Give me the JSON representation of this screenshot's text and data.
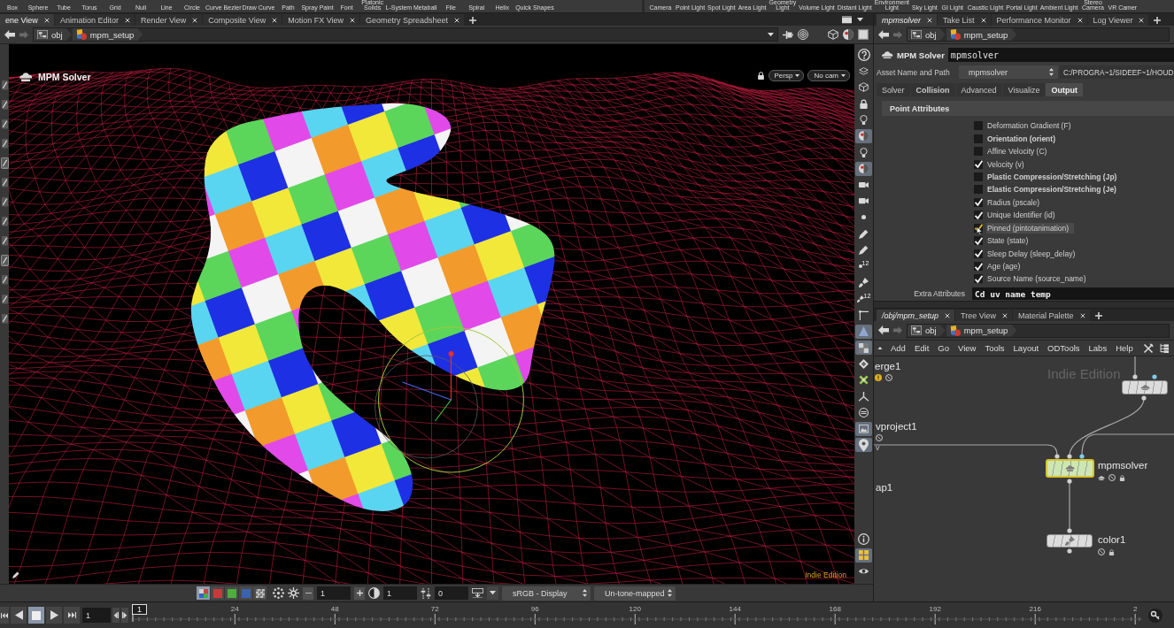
{
  "shelf": {
    "create_tools": [
      "Box",
      "Sphere",
      "Tube",
      "Torus",
      "Grid",
      "Null",
      "Line",
      "Circle",
      "Curve Bezier",
      "Draw Curve",
      "Path",
      "Spray Paint",
      "Font",
      "Platonic\nSolids",
      "L-System",
      "Metaball",
      "File",
      "Spiral",
      "Helix",
      "Quick Shapes"
    ],
    "light_tools": [
      "Camera",
      "Point Light",
      "Spot Light",
      "Area Light",
      "Geometry\nLight",
      "Volume Light",
      "Distant Light",
      "Environment\nLight",
      "Sky Light",
      "GI Light",
      "Caustic Light",
      "Portal Light",
      "Ambient Light",
      "Stereo\nCamera",
      "VR Camer"
    ]
  },
  "scene_tabs": [
    {
      "label": "ene View",
      "selected": true
    },
    {
      "label": "Animation Editor",
      "selected": false
    },
    {
      "label": "Render View",
      "selected": false
    },
    {
      "label": "Composite View",
      "selected": false
    },
    {
      "label": "Motion FX View",
      "selected": false
    },
    {
      "label": "Geometry Spreadsheet",
      "selected": false
    }
  ],
  "scene_path": [
    "obj",
    "mpm_setup"
  ],
  "left_tools": [
    {
      "selected": false
    },
    {
      "selected": false
    },
    {
      "selected": false
    },
    {
      "selected": false
    },
    {
      "selected": true
    },
    {
      "selected": false
    },
    {
      "selected": false
    },
    {
      "selected": false
    },
    {
      "selected": false
    },
    {
      "selected": true
    },
    {
      "selected": false
    },
    {
      "selected": false
    },
    {
      "selected": false
    }
  ],
  "viewport": {
    "title": "MPM Solver",
    "camera_menus": [
      "Persp",
      "No cam"
    ],
    "edition": "Indie Edition"
  },
  "viewport_tools": [
    {
      "kind": "help",
      "selected": false
    },
    {
      "kind": "layers",
      "selected": false
    },
    {
      "kind": "cube",
      "selected": false
    },
    {
      "kind": "lock",
      "selected": false
    },
    {
      "kind": "bulb",
      "selected": false
    },
    {
      "kind": "sphere",
      "selected": true
    },
    {
      "kind": "bulb",
      "selected": false
    },
    {
      "kind": "sphere",
      "selected": true
    },
    {
      "kind": "camera",
      "selected": false
    },
    {
      "kind": "camera",
      "selected": false
    },
    {
      "kind": "dot",
      "selected": false
    },
    {
      "kind": "pen",
      "selected": false
    },
    {
      "kind": "pen",
      "selected": false
    },
    {
      "kind": "dot",
      "selected": false,
      "badge": "12"
    },
    {
      "kind": "brush",
      "selected": false
    },
    {
      "kind": "brush",
      "selected": false,
      "badge": "12"
    },
    {
      "kind": "corner",
      "selected": false
    },
    {
      "kind": "triangle",
      "selected": true
    },
    {
      "kind": "checker",
      "selected": true
    },
    {
      "kind": "diamond",
      "selected": false
    },
    {
      "kind": "cross",
      "selected": false
    },
    {
      "kind": "tripod",
      "selected": false
    },
    {
      "kind": "ring",
      "selected": false
    },
    {
      "kind": "image",
      "selected": true
    },
    {
      "kind": "pin",
      "selected": true
    }
  ],
  "viewport_tools_bottom": [
    {
      "kind": "info",
      "selected": false
    },
    {
      "kind": "grid",
      "selected": true
    },
    {
      "kind": "eye",
      "selected": false
    }
  ],
  "display_bar": {
    "channels": [
      {
        "kind": "rgb",
        "selected": true
      },
      {
        "kind": "single",
        "color": "#c83a3a",
        "selected": false
      },
      {
        "kind": "single",
        "color": "#4caf3c",
        "selected": false
      },
      {
        "kind": "single",
        "color": "#3a62b0",
        "selected": false
      },
      {
        "kind": "alpha",
        "selected": false
      }
    ],
    "spinners": [
      {
        "kind": "stepper",
        "value": "1"
      },
      {
        "kind": "contrast",
        "value": "1"
      },
      {
        "kind": "adjust",
        "value": "0"
      }
    ],
    "dropdowns": [
      "sRGB - Display",
      "Un-tone-mapped"
    ]
  },
  "parameter_tabs": [
    {
      "label": "mpmsolver",
      "selected": true,
      "following": true
    },
    {
      "label": "Take List",
      "selected": false,
      "following": false
    },
    {
      "label": "Performance Monitor",
      "selected": false,
      "following": false
    },
    {
      "label": "Log Viewer",
      "selected": false,
      "following": false
    }
  ],
  "parameter_path": [
    "obj",
    "mpm_setup"
  ],
  "parameters": {
    "operator": "MPM Solver",
    "node_name": "mpmsolver",
    "asset_label": "Asset Name and Path",
    "asset_name": "mpmsolver",
    "asset_path": "C:/PROGRA~1/SIDEEF~1/HOUD",
    "tabs": [
      {
        "label": "Solver",
        "selected": false,
        "modified": false
      },
      {
        "label": "Collision",
        "selected": false,
        "modified": true
      },
      {
        "label": "Advanced",
        "selected": false,
        "modified": false
      },
      {
        "label": "Visualize",
        "selected": false,
        "modified": false
      },
      {
        "label": "Output",
        "selected": true,
        "modified": true
      }
    ],
    "section": "Point Attributes",
    "attributes": [
      {
        "label": "Deformation Gradient (F)",
        "checked": false,
        "modified": false,
        "hovered": false
      },
      {
        "label": "Orientation (orient)",
        "checked": false,
        "modified": true,
        "hovered": false
      },
      {
        "label": "Affine Velocity (C)",
        "checked": false,
        "modified": false,
        "hovered": false
      },
      {
        "label": "Velocity (v)",
        "checked": true,
        "modified": false,
        "hovered": false
      },
      {
        "label": "Plastic Compression/Stretching (Jp)",
        "checked": false,
        "modified": true,
        "hovered": false
      },
      {
        "label": "Elastic Compression/Stretching (Je)",
        "checked": false,
        "modified": true,
        "hovered": false
      },
      {
        "label": "Radius (pscale)",
        "checked": true,
        "modified": false,
        "hovered": false
      },
      {
        "label": "Unique Identifier (id)",
        "checked": true,
        "modified": false,
        "hovered": false
      },
      {
        "label": "Pinned (pintotanimation)",
        "checked": true,
        "modified": false,
        "hovered": true
      },
      {
        "label": "State (state)",
        "checked": true,
        "modified": false,
        "hovered": false
      },
      {
        "label": "Sleep Delay (sleep_delay)",
        "checked": true,
        "modified": false,
        "hovered": false
      },
      {
        "label": "Age (age)",
        "checked": true,
        "modified": false,
        "hovered": false
      },
      {
        "label": "Source Name (source_name)",
        "checked": true,
        "modified": false,
        "hovered": false
      }
    ],
    "extra_label": "Extra Attributes",
    "extra_value": "Cd uv name temp"
  },
  "network_tabs": [
    {
      "label": "/obj/mpm_setup",
      "selected": true,
      "following": true
    },
    {
      "label": "Tree View",
      "selected": false,
      "following": false
    },
    {
      "label": "Material Palette",
      "selected": false,
      "following": false
    }
  ],
  "network_path": [
    "obj",
    "mpm_setup"
  ],
  "network_menu": [
    "Add",
    "Edit",
    "Go",
    "View",
    "Tools",
    "Layout",
    "ODTools",
    "Labs",
    "Help"
  ],
  "network": {
    "watermark": "Indie Edition",
    "wire_label": "v",
    "nodes": [
      {
        "kind": "offscreen",
        "name": "erge1",
        "selected": false
      },
      {
        "kind": "offscreen",
        "name": "vproject1",
        "selected": false
      },
      {
        "kind": "offscreen",
        "name": "ap1",
        "selected": false
      },
      {
        "kind": "node",
        "selected": false
      },
      {
        "kind": "node",
        "name": "mpmsolver",
        "selected": true
      },
      {
        "kind": "node",
        "name": "color1",
        "selected": false
      }
    ]
  },
  "timeline": {
    "buttons": [
      {
        "kind": "first",
        "selected": false
      },
      {
        "kind": "prev",
        "selected": false
      },
      {
        "kind": "stop",
        "selected": true
      },
      {
        "kind": "play",
        "selected": false
      },
      {
        "kind": "last",
        "selected": false
      }
    ],
    "frame": "1",
    "current": "1",
    "ticks": [
      "24",
      "48",
      "72",
      "96",
      "120",
      "144",
      "168",
      "192",
      "216",
      "2"
    ]
  }
}
